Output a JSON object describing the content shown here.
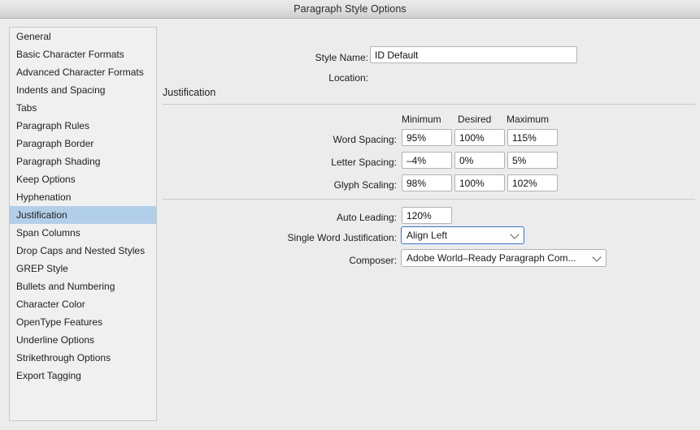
{
  "window": {
    "title": "Paragraph Style Options"
  },
  "sidebar": {
    "items": [
      {
        "label": "General",
        "selected": false
      },
      {
        "label": "Basic Character Formats",
        "selected": false
      },
      {
        "label": "Advanced Character Formats",
        "selected": false
      },
      {
        "label": "Indents and Spacing",
        "selected": false
      },
      {
        "label": "Tabs",
        "selected": false
      },
      {
        "label": "Paragraph Rules",
        "selected": false
      },
      {
        "label": "Paragraph Border",
        "selected": false
      },
      {
        "label": "Paragraph Shading",
        "selected": false
      },
      {
        "label": "Keep Options",
        "selected": false
      },
      {
        "label": "Hyphenation",
        "selected": false
      },
      {
        "label": "Justification",
        "selected": true
      },
      {
        "label": "Span Columns",
        "selected": false
      },
      {
        "label": "Drop Caps and Nested Styles",
        "selected": false
      },
      {
        "label": "GREP Style",
        "selected": false
      },
      {
        "label": "Bullets and Numbering",
        "selected": false
      },
      {
        "label": "Character Color",
        "selected": false
      },
      {
        "label": "OpenType Features",
        "selected": false
      },
      {
        "label": "Underline Options",
        "selected": false
      },
      {
        "label": "Strikethrough Options",
        "selected": false
      },
      {
        "label": "Export Tagging",
        "selected": false
      }
    ]
  },
  "header": {
    "style_name_label": "Style Name:",
    "style_name_value": "ID Default",
    "location_label": "Location:",
    "location_value": ""
  },
  "justification": {
    "section_title": "Justification",
    "columns": [
      "Minimum",
      "Desired",
      "Maximum"
    ],
    "rows": [
      {
        "label": "Word Spacing:",
        "minimum": "95%",
        "desired": "100%",
        "maximum": "115%"
      },
      {
        "label": "Letter Spacing:",
        "minimum": "–4%",
        "desired": "0%",
        "maximum": "5%"
      },
      {
        "label": "Glyph Scaling:",
        "minimum": "98%",
        "desired": "100%",
        "maximum": "102%"
      }
    ],
    "auto_leading_label": "Auto Leading:",
    "auto_leading_value": "120%",
    "single_word_label": "Single Word Justification:",
    "single_word_value": "Align Left",
    "composer_label": "Composer:",
    "composer_value": "Adobe World–Ready Paragraph Com..."
  },
  "colors": {
    "selection": "#b2cfe9",
    "focus_border": "#3b76c9",
    "panel_background": "#ececec",
    "field_border": "#b3b3b3"
  }
}
